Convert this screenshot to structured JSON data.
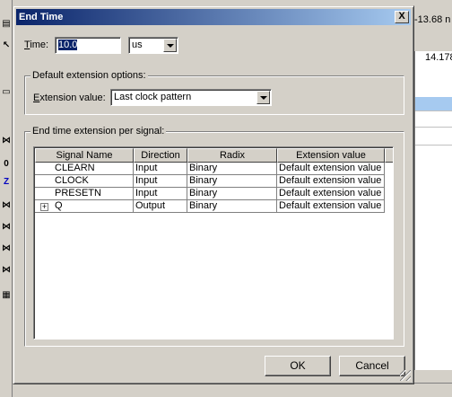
{
  "background": {
    "time_readout": "-13.68 n",
    "cursor_readout": "14.178"
  },
  "dialog": {
    "title": "End Time",
    "close_glyph": "X",
    "time": {
      "label_hotkey": "T",
      "label_rest": "ime:",
      "value": "10.0",
      "unit": "us"
    },
    "default_ext": {
      "group_title": "Default extension options:",
      "label_hotkey": "E",
      "label_rest": "xtension value:",
      "value": "Last clock pattern"
    },
    "per_signal": {
      "group_title": "End time extension per signal:",
      "columns": [
        "Signal Name",
        "Direction",
        "Radix",
        "Extension value"
      ],
      "rows": [
        {
          "signal": "CLEARN",
          "direction": "Input",
          "radix": "Binary",
          "extension": "Default extension value",
          "expandable": false
        },
        {
          "signal": "CLOCK",
          "direction": "Input",
          "radix": "Binary",
          "extension": "Default extension value",
          "expandable": false
        },
        {
          "signal": "PRESETN",
          "direction": "Input",
          "radix": "Binary",
          "extension": "Default extension value",
          "expandable": false
        },
        {
          "signal": "Q",
          "direction": "Output",
          "radix": "Binary",
          "extension": "Default extension value",
          "expandable": true
        }
      ]
    },
    "ok_label": "OK",
    "cancel_label": "Cancel"
  },
  "colors": {
    "title_start": "#0a246a",
    "title_end": "#a6caf0",
    "face": "#d4d0c8",
    "selection": "#0a246a"
  }
}
